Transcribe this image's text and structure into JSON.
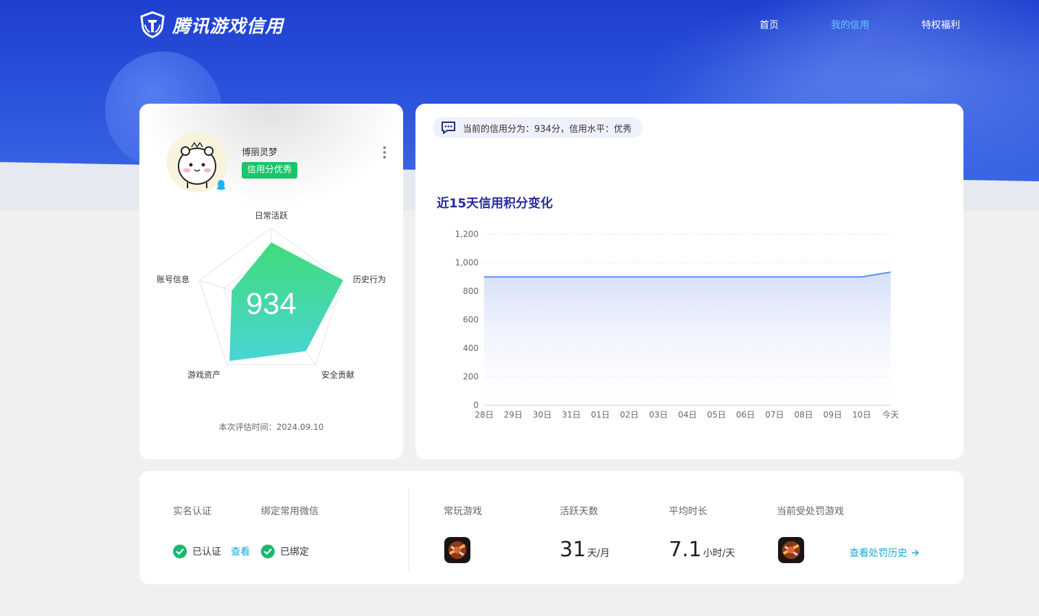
{
  "brand": {
    "name": "腾讯游戏信用"
  },
  "nav": {
    "home": "首页",
    "my_credit": "我的信用",
    "privileges": "特权福利"
  },
  "profile": {
    "username": "博丽灵梦",
    "credit_tag": "信用分优秀",
    "score": "934",
    "eval_time": "本次评估时间：2024.09.10",
    "radar": {
      "labels": [
        "日常活跃",
        "历史行为",
        "安全贡献",
        "游戏资产",
        "账号信息"
      ],
      "values": [
        0.81,
        1.0,
        0.78,
        0.94,
        0.55
      ]
    }
  },
  "summary": {
    "text": "当前的信用分为：934分，信用水平：优秀"
  },
  "chart": {
    "title": "近15天信用积分变化"
  },
  "chart_data": {
    "type": "area",
    "x": [
      "28日",
      "29日",
      "30日",
      "31日",
      "01日",
      "02日",
      "03日",
      "04日",
      "05日",
      "06日",
      "07日",
      "08日",
      "09日",
      "10日",
      "今天"
    ],
    "series": [
      {
        "values": [
          900,
          900,
          900,
          900,
          900,
          900,
          900,
          900,
          900,
          900,
          900,
          900,
          900,
          900,
          934
        ]
      }
    ],
    "ylim": [
      0,
      1200
    ],
    "yticks": [
      "0",
      "200",
      "400",
      "600",
      "800",
      "1,000",
      "1,200"
    ],
    "grid": true,
    "color": "#5b8ff0"
  },
  "bottom": {
    "real_name_label": "实名认证",
    "real_name_status": "已认证",
    "view_link": "查看",
    "wechat_label": "绑定常用微信",
    "wechat_status": "已绑定",
    "fav_game_label": "常玩游戏",
    "active_days_label": "活跃天数",
    "active_days_value": "31",
    "active_days_unit": "天/月",
    "avg_time_label": "平均时长",
    "avg_time_value": "7.1",
    "avg_time_unit": "小时/天",
    "punished_label": "当前受处罚游戏",
    "history_link": "查看处罚历史"
  },
  "colors": {
    "accent": "#18c568",
    "link": "#18a6d8",
    "brand_blue": "#2a52dc"
  }
}
